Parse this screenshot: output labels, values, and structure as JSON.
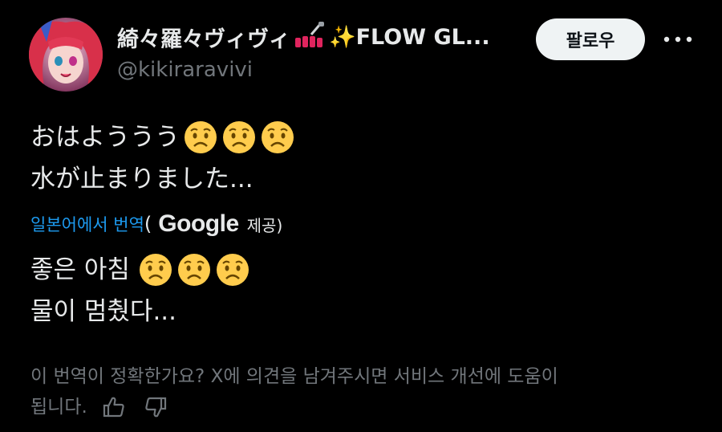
{
  "author": {
    "display_name": "綺々羅々ヴィヴィ",
    "display_name_suffix": "✨FLOW GL...",
    "handle": "@kikiraravivi",
    "avatar": "avatar-illustration"
  },
  "actions": {
    "follow_label": "팔로우",
    "more_icon": "more-horizontal-icon"
  },
  "tweet": {
    "line1": "おはよううう",
    "line2": "水が止まりました..."
  },
  "translation": {
    "link_label": "일본어에서 번역",
    "paren_open": "(",
    "provider": "Google",
    "provided_label": "제공)",
    "line1": "좋은 아침",
    "line2": "물이 멈췄다..."
  },
  "feedback": {
    "line1": "이 번역이 정확한가요? X에 의견을 남겨주시면 서비스 개선에 도움이",
    "line2": "됩니다.",
    "thumbs_up_icon": "thumbs-up-icon",
    "thumbs_down_icon": "thumbs-down-icon"
  },
  "colors": {
    "background": "#000000",
    "text": "#e7e9ea",
    "muted": "#71767b",
    "link": "#1d9bf0",
    "follow_bg": "#eff3f4"
  }
}
